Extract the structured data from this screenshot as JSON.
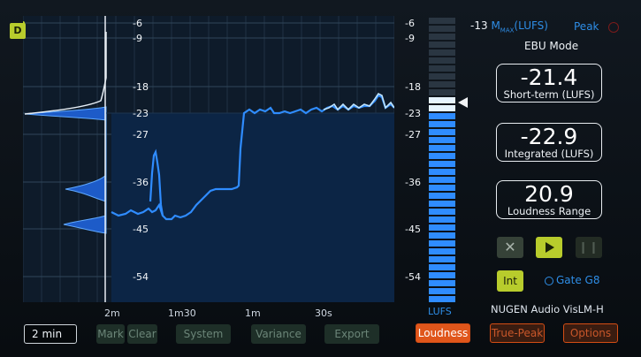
{
  "top_left_badge": "D",
  "left_scale": [
    "-6",
    "-9",
    "-18",
    "-23",
    "-27",
    "-36",
    "-45",
    "-54"
  ],
  "right_scale": [
    "-6",
    "-9",
    "-18",
    "-23",
    "-27",
    "-36",
    "-45",
    "-54"
  ],
  "time_axis": [
    "2m",
    "1m30",
    "1m",
    "30s"
  ],
  "meter_label": "LUFS",
  "header": {
    "target_value": "-13",
    "target_sym": "M",
    "target_sub": "MAX",
    "target_unit": "(LUFS)",
    "peak_label": "Peak",
    "mode": "EBU Mode"
  },
  "readouts": {
    "short_term": {
      "value": "-21.4",
      "label": "Short-term (LUFS)"
    },
    "integrated": {
      "value": "-22.9",
      "label": "Integrated (LUFS)"
    },
    "loudness_range": {
      "value": "20.9",
      "label": "Loudness Range"
    }
  },
  "transport": {
    "int_label": "Int",
    "gate_label": "Gate G8"
  },
  "brand": "NUGEN Audio VisLM-H",
  "bottom": {
    "duration": "2 min",
    "mark": "Mark",
    "clear": "Clear",
    "system": "System",
    "variance": "Variance",
    "export": "Export",
    "loudness": "Loudness",
    "true_peak": "True-Peak",
    "options": "Options"
  },
  "colors": {
    "accent_yellow": "#b8cc2c",
    "curve_blue": "#2f8cff",
    "orange": "#e0561b",
    "label_blue": "#2e8de6"
  }
}
